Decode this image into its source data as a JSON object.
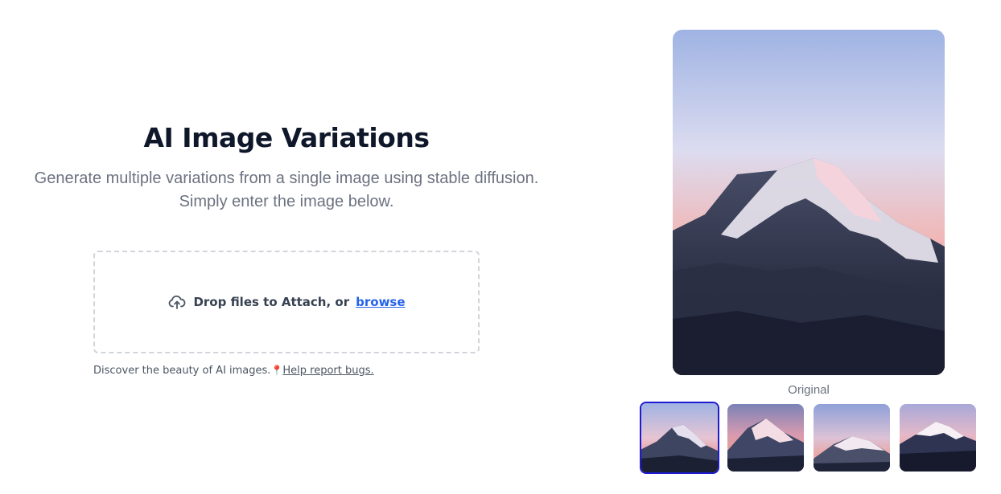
{
  "header": {
    "title": "AI Image Variations",
    "subtitle": "Generate multiple variations from a single image using stable diffusion. Simply enter the image below."
  },
  "dropzone": {
    "text": "Drop files to Attach, or",
    "browse_label": "browse",
    "icon": "upload-cloud-icon"
  },
  "footnote": {
    "text": "Discover the beauty of AI images.",
    "pin_icon": "pin-icon",
    "link_label": "Help report bugs."
  },
  "preview": {
    "caption": "Original",
    "thumbnails": [
      {
        "name": "original",
        "selected": true
      },
      {
        "name": "variation-1",
        "selected": false
      },
      {
        "name": "variation-2",
        "selected": false
      },
      {
        "name": "variation-3",
        "selected": false
      }
    ]
  },
  "colors": {
    "accent_link": "#2563eb",
    "selected_border": "#1d1ad1",
    "title": "#0f172a",
    "muted": "#6b7280"
  }
}
